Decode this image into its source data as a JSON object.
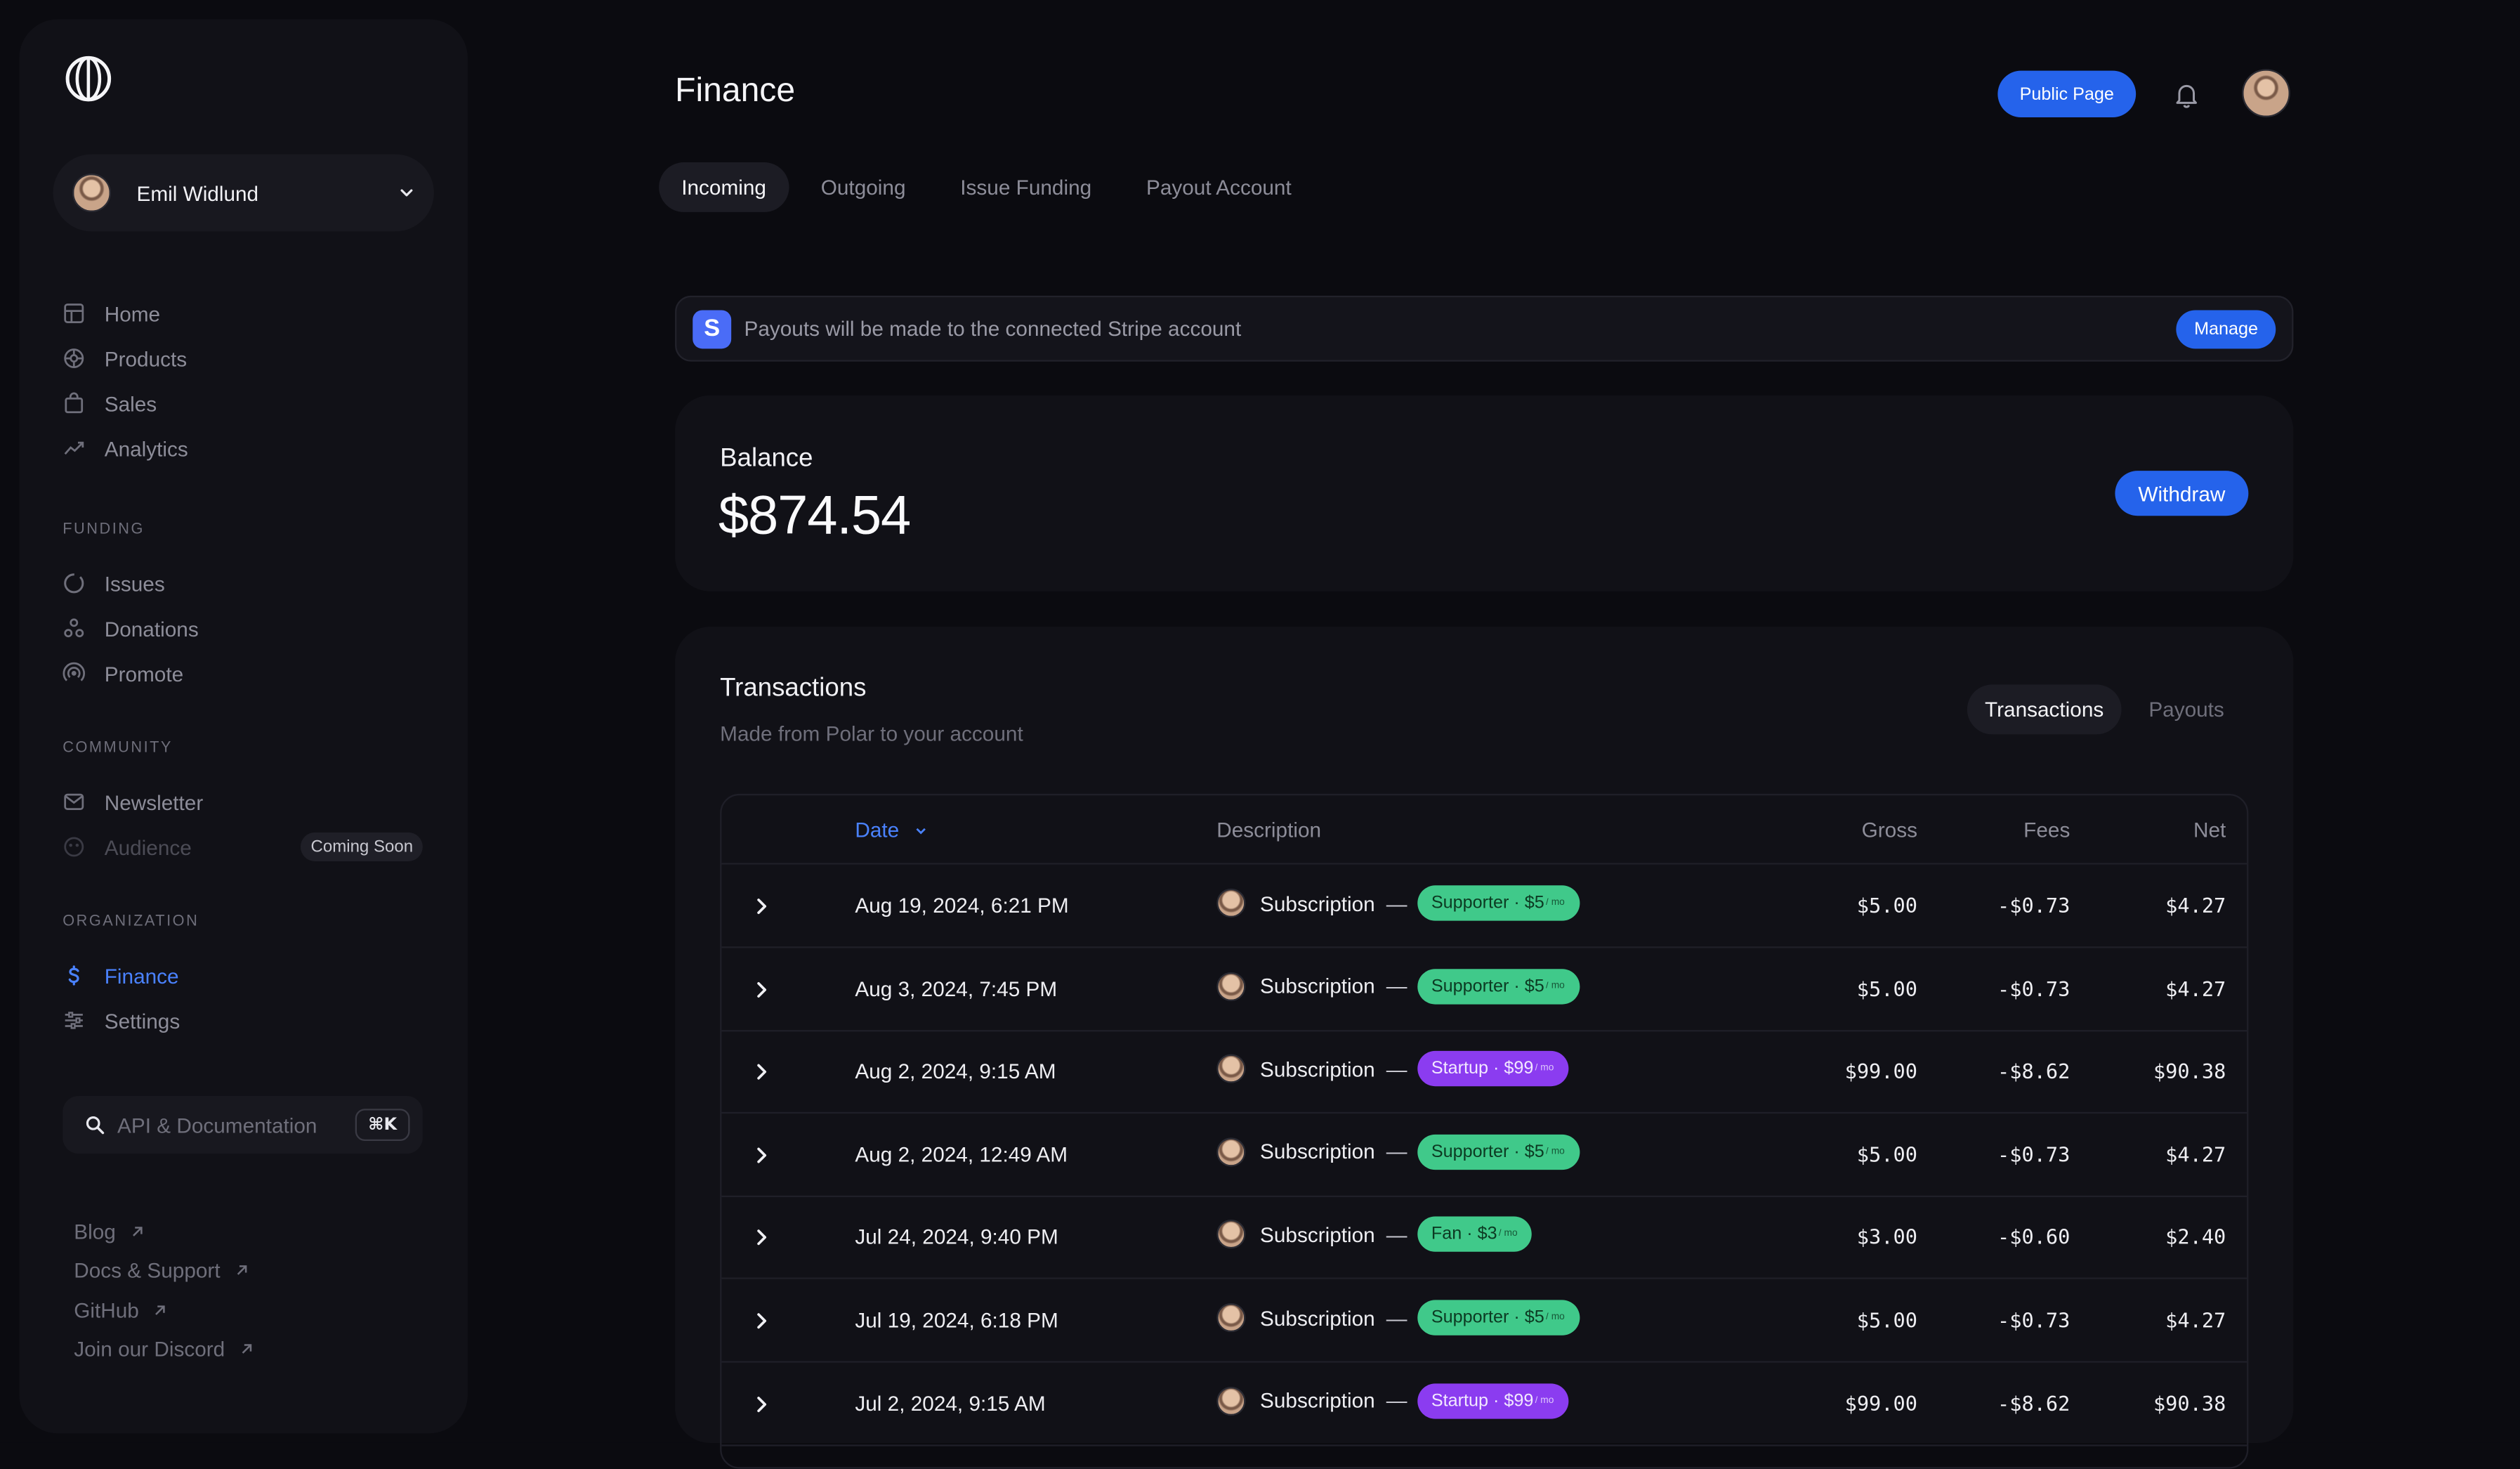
{
  "sidebar": {
    "account_name": "Emil Widlund",
    "nav_main": [
      {
        "label": "Home",
        "icon": "home-icon"
      },
      {
        "label": "Products",
        "icon": "products-icon"
      },
      {
        "label": "Sales",
        "icon": "bag-icon"
      },
      {
        "label": "Analytics",
        "icon": "trend-icon"
      }
    ],
    "funding_label": "FUNDING",
    "nav_funding": [
      {
        "label": "Issues",
        "icon": "issues-icon"
      },
      {
        "label": "Donations",
        "icon": "donations-icon"
      },
      {
        "label": "Promote",
        "icon": "broadcast-icon"
      }
    ],
    "community_label": "COMMUNITY",
    "nav_community": [
      {
        "label": "Newsletter",
        "icon": "mail-icon"
      },
      {
        "label": "Audience",
        "icon": "audience-icon",
        "badge": "Coming Soon"
      }
    ],
    "organization_label": "ORGANIZATION",
    "nav_org": [
      {
        "label": "Finance",
        "icon": "dollar-icon"
      },
      {
        "label": "Settings",
        "icon": "sliders-icon"
      }
    ],
    "search_placeholder": "API & Documentation",
    "search_shortcut": "⌘K",
    "links": [
      "Blog",
      "Docs & Support",
      "GitHub",
      "Join our Discord"
    ]
  },
  "header": {
    "title": "Finance",
    "public_page_label": "Public Page"
  },
  "tabs": [
    "Incoming",
    "Outgoing",
    "Issue Funding",
    "Payout Account"
  ],
  "banner": {
    "icon_letter": "S",
    "text": "Payouts will be made to the connected Stripe account",
    "button_label": "Manage"
  },
  "balance": {
    "label": "Balance",
    "value": "$874.54",
    "button_label": "Withdraw"
  },
  "transactions": {
    "title": "Transactions",
    "subtitle": "Made from Polar to your account",
    "segments": [
      "Transactions",
      "Payouts"
    ],
    "columns": {
      "date": "Date",
      "description": "Description",
      "gross": "Gross",
      "fees": "Fees",
      "net": "Net"
    },
    "rows": [
      {
        "date": "Aug 19, 2024, 6:21 PM",
        "desc": "Subscription",
        "tier": "Supporter · $5",
        "per": "/ mo",
        "color": "green",
        "gross": "$5.00",
        "fees": "-$0.73",
        "net": "$4.27"
      },
      {
        "date": "Aug 3, 2024, 7:45 PM",
        "desc": "Subscription",
        "tier": "Supporter · $5",
        "per": "/ mo",
        "color": "green",
        "gross": "$5.00",
        "fees": "-$0.73",
        "net": "$4.27"
      },
      {
        "date": "Aug 2, 2024, 9:15 AM",
        "desc": "Subscription",
        "tier": "Startup · $99",
        "per": "/ mo",
        "color": "purple",
        "gross": "$99.00",
        "fees": "-$8.62",
        "net": "$90.38"
      },
      {
        "date": "Aug 2, 2024, 12:49 AM",
        "desc": "Subscription",
        "tier": "Supporter · $5",
        "per": "/ mo",
        "color": "green",
        "gross": "$5.00",
        "fees": "-$0.73",
        "net": "$4.27"
      },
      {
        "date": "Jul 24, 2024, 9:40 PM",
        "desc": "Subscription",
        "tier": "Fan · $3",
        "per": "/ mo",
        "color": "green",
        "gross": "$3.00",
        "fees": "-$0.60",
        "net": "$2.40"
      },
      {
        "date": "Jul 19, 2024, 6:18 PM",
        "desc": "Subscription",
        "tier": "Supporter · $5",
        "per": "/ mo",
        "color": "green",
        "gross": "$5.00",
        "fees": "-$0.73",
        "net": "$4.27"
      },
      {
        "date": "Jul 2, 2024, 9:15 AM",
        "desc": "Subscription",
        "tier": "Startup · $99",
        "per": "/ mo",
        "color": "purple",
        "gross": "$99.00",
        "fees": "-$8.62",
        "net": "$90.38"
      }
    ]
  },
  "colors": {
    "accent": "#2563eb",
    "active_link": "#4a82ff",
    "pill_green": "#40c98a",
    "pill_purple": "#8b3cf0",
    "background": "#0b0b10",
    "card": "#111117"
  }
}
